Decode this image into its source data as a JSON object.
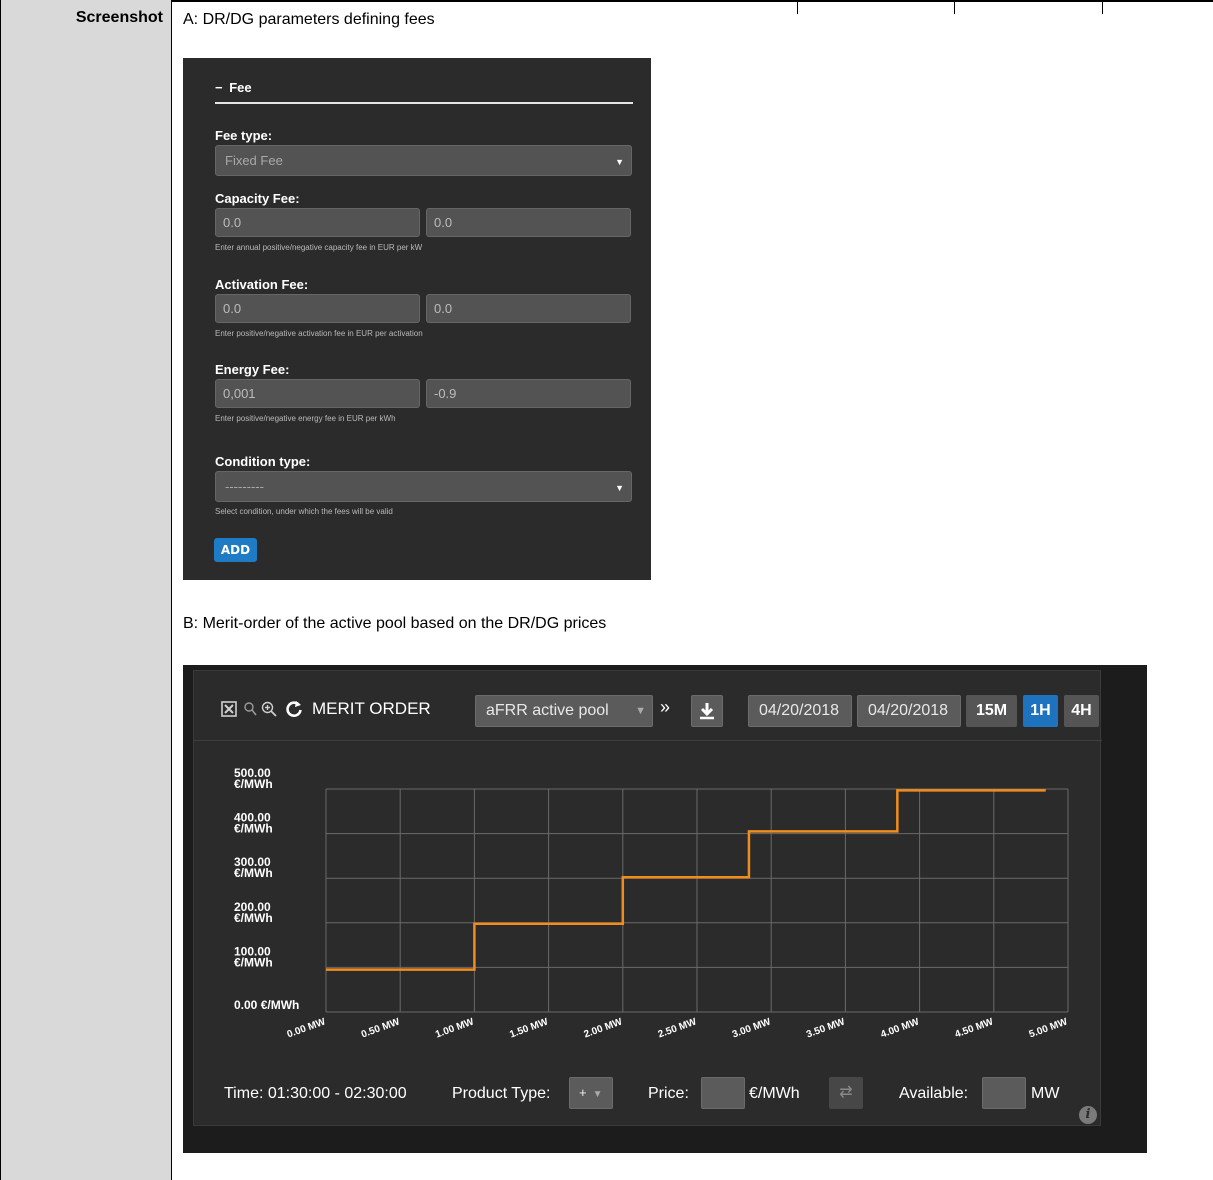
{
  "table": {
    "row_label": "Screenshot"
  },
  "section_a": {
    "caption": "A: DR/DG parameters defining fees"
  },
  "fee_form": {
    "header": "Fee",
    "fee_type": {
      "label": "Fee type:",
      "value": "Fixed Fee"
    },
    "capacity_fee": {
      "label": "Capacity Fee:",
      "positive_value": "0.0",
      "negative_value": "0.0",
      "help": "Enter annual positive/negative capacity fee in EUR per kW"
    },
    "activation_fee": {
      "label": "Activation Fee:",
      "positive_value": "0.0",
      "negative_value": "0.0",
      "help": "Enter positive/negative activation fee in EUR per activation"
    },
    "energy_fee": {
      "label": "Energy Fee:",
      "positive_value": "0,001",
      "negative_value": "-0.9",
      "help": "Enter positive/negative energy fee in EUR per kWh"
    },
    "condition_type": {
      "label": "Condition type:",
      "value": "---------",
      "help": "Select condition, under which the fees will be valid"
    },
    "add_button": "ADD"
  },
  "section_b": {
    "caption": "B: Merit-order of the active pool based on the DR/DG prices"
  },
  "merit_order": {
    "title": "MERIT ORDER",
    "pool_select": "aFRR active pool",
    "date_from": "04/20/2018",
    "date_to": "04/20/2018",
    "intervals": [
      {
        "label": "15M",
        "active": false
      },
      {
        "label": "1H",
        "active": true
      },
      {
        "label": "4H",
        "active": false
      }
    ],
    "time_label": "Time: 01:30:00 - 02:30:00",
    "product_type_label": "Product Type:",
    "product_type_value": "+",
    "price_label": "Price:",
    "price_unit": "€/MWh",
    "available_label": "Available:",
    "available_unit": "MW",
    "colors": {
      "line": "#f28c1c",
      "active_button": "#1e73be"
    }
  },
  "chart_data": {
    "type": "line",
    "step": true,
    "title": "",
    "xlabel": "",
    "ylabel": "",
    "x_ticks": [
      "0.00 MW",
      "0.50 MW",
      "1.00 MW",
      "1.50 MW",
      "2.00 MW",
      "2.50 MW",
      "3.00 MW",
      "3.50 MW",
      "4.00 MW",
      "4.50 MW",
      "5.00 MW"
    ],
    "y_ticks": [
      "0.00 €/MWh",
      "100.00 €/MWh",
      "200.00 €/MWh",
      "300.00 €/MWh",
      "400.00 €/MWh",
      "500.00 €/MWh"
    ],
    "xlim": [
      0,
      5
    ],
    "ylim": [
      0,
      500
    ],
    "grid": true,
    "series": [
      {
        "x": [
          0,
          1.0,
          1.0,
          2.0,
          2.0,
          2.85,
          2.85,
          3.85,
          3.85,
          4.85
        ],
        "y": [
          95,
          95,
          198,
          198,
          302,
          302,
          405,
          405,
          497,
          497
        ]
      }
    ]
  }
}
